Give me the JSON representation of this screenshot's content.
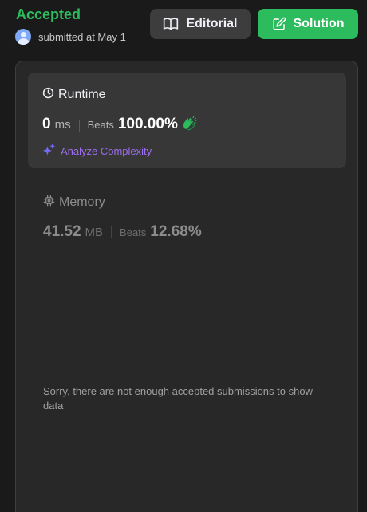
{
  "header": {
    "status": "Accepted",
    "submitted_text": "submitted at May 1",
    "editorial_label": "Editorial",
    "solution_label": "Solution"
  },
  "runtime": {
    "title": "Runtime",
    "value": "0",
    "unit": "ms",
    "beats_label": "Beats",
    "beats_pct": "100.00%",
    "analyze_label": "Analyze Complexity"
  },
  "memory": {
    "title": "Memory",
    "value": "41.52",
    "unit": "MB",
    "beats_label": "Beats",
    "beats_pct": "12.68%"
  },
  "chart": {
    "empty_message": "Sorry, there are not enough accepted submissions to show data"
  },
  "colors": {
    "accent_green": "#2cbb5d",
    "analyze_purple": "#9f6df0",
    "panel_bg": "#282828",
    "card_bg": "#373737"
  },
  "icons": {
    "avatar": "user-avatar-icon",
    "editorial": "book-open-icon",
    "solution": "edit-icon",
    "runtime": "clock-icon",
    "beats_badge": "clapping-hands-icon",
    "analyze": "sparkle-icon",
    "memory": "chip-icon"
  }
}
